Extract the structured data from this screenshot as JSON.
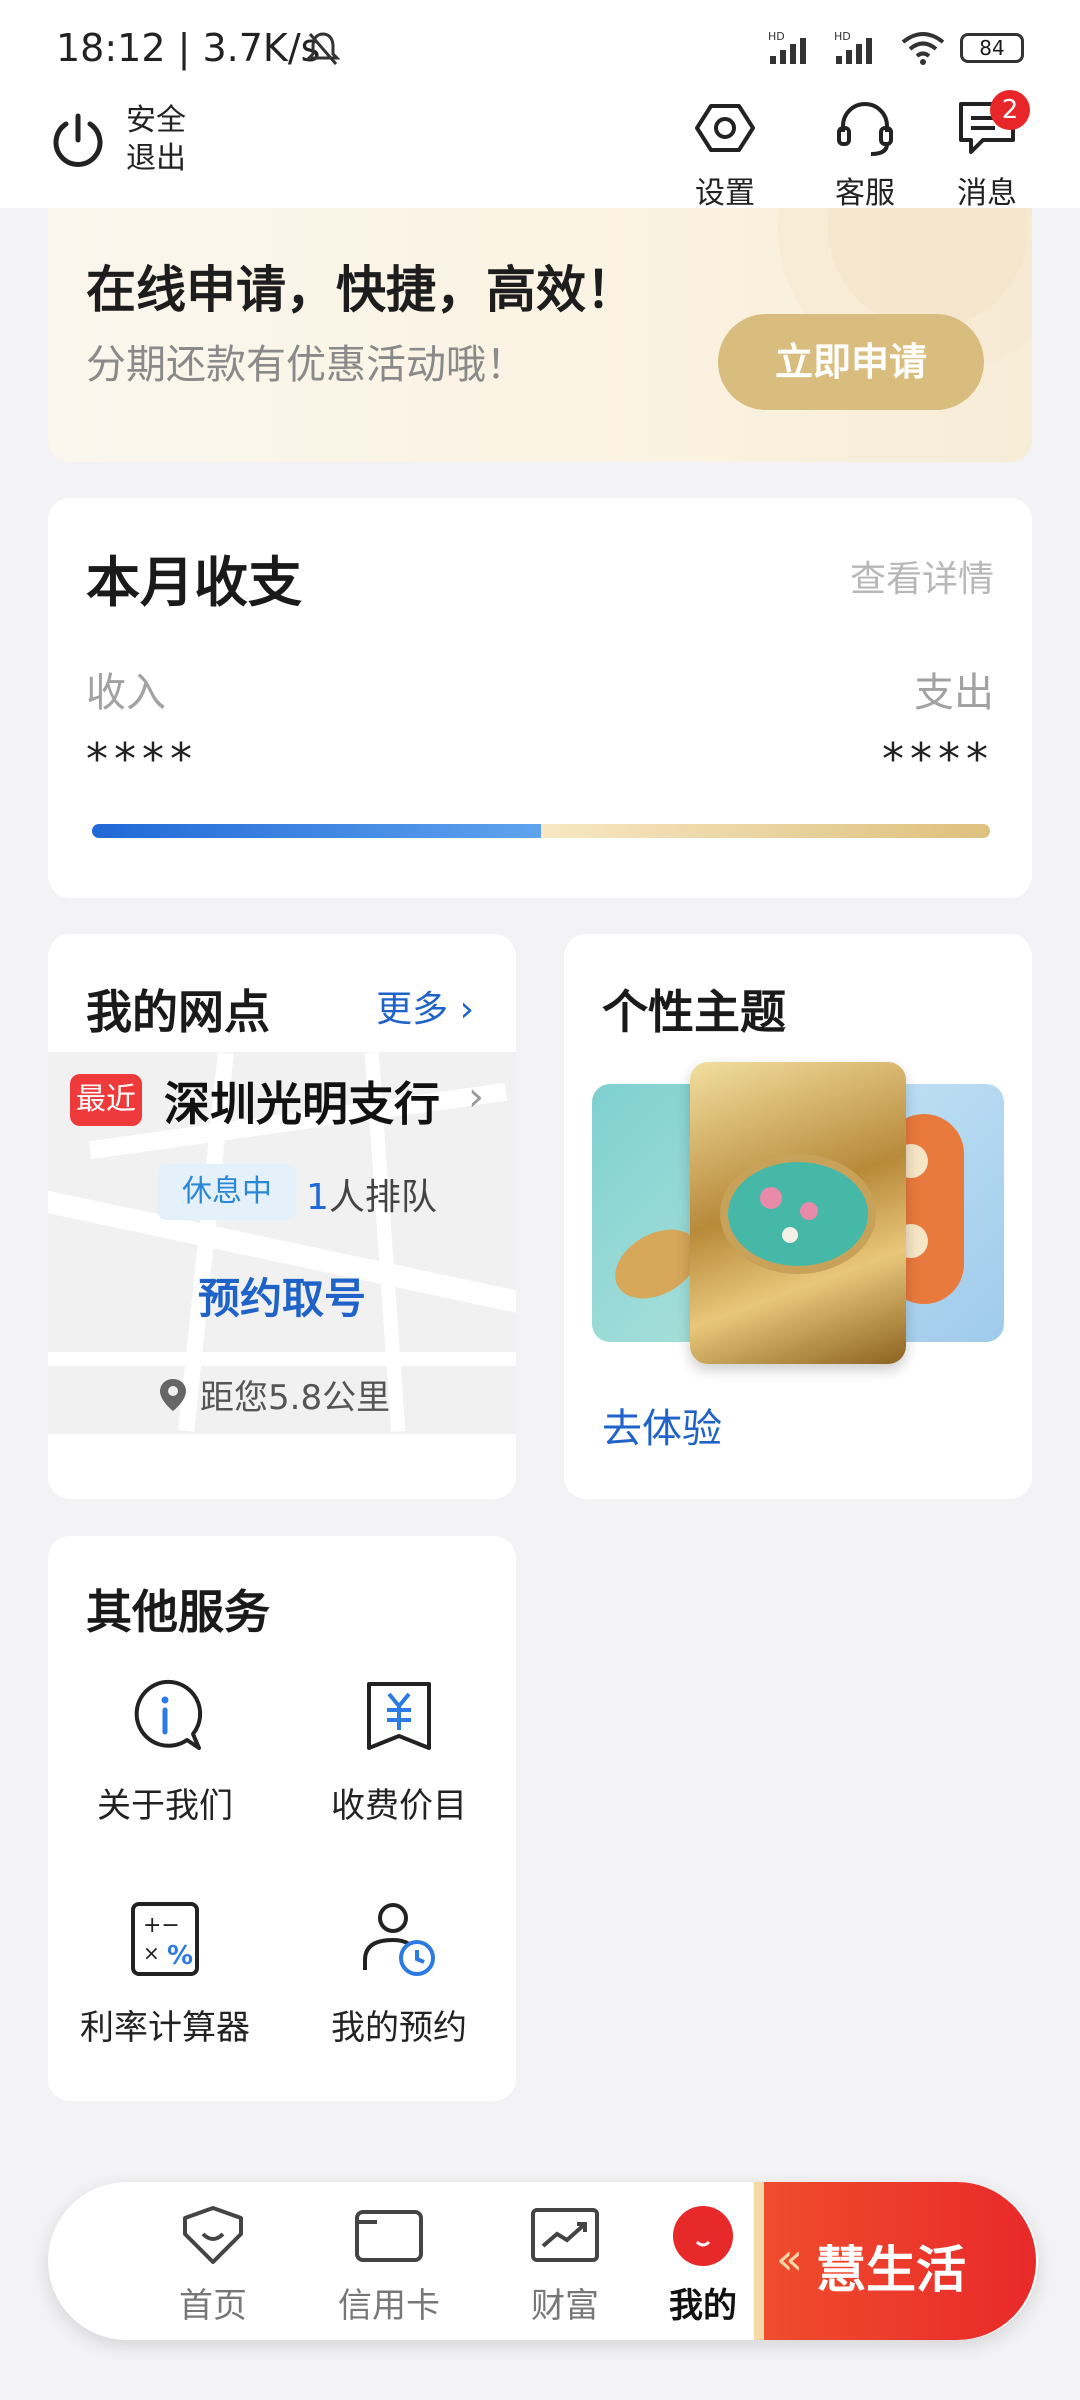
{
  "status_bar": {
    "time": "18:12 | 3.7K/s",
    "battery": "84"
  },
  "header": {
    "logout_label_1": "安全",
    "logout_label_2": "退出",
    "settings_label": "设置",
    "service_label": "客服",
    "messages_label": "消息",
    "messages_badge": "2"
  },
  "promo": {
    "title": "在线申请，快捷，高效！",
    "subtitle": "分期还款有优惠活动哦！",
    "button": "立即申请"
  },
  "income_card": {
    "title": "本月收支",
    "detail_link": "查看详情",
    "income_label": "收入",
    "expense_label": "支出",
    "income_value": "****",
    "expense_value": "****",
    "income_fraction": 0.5
  },
  "branch_card": {
    "title": "我的网点",
    "more": "更多",
    "recent_tag": "最近",
    "branch_name": "深圳光明支行",
    "status_tag": "休息中",
    "queue_count": "1",
    "queue_text": "人排队",
    "reserve_button": "预约取号",
    "distance": "距您5.8公里"
  },
  "theme_card": {
    "title": "个性主题",
    "try_link": "去体验"
  },
  "other_services": {
    "title": "其他服务",
    "items": [
      {
        "label": "关于我们",
        "icon": "info-icon"
      },
      {
        "label": "收费价目",
        "icon": "price-book-icon"
      },
      {
        "label": "利率计算器",
        "icon": "calculator-icon"
      },
      {
        "label": "我的预约",
        "icon": "appointment-icon"
      }
    ]
  },
  "tabbar": {
    "items": [
      {
        "label": "首页",
        "icon": "home-icon"
      },
      {
        "label": "信用卡",
        "icon": "credit-card-icon"
      },
      {
        "label": "财富",
        "icon": "wealth-icon"
      },
      {
        "label": "我的",
        "icon": "profile-icon"
      }
    ],
    "life_label": "慧生活",
    "active_color": "#e8292a"
  }
}
